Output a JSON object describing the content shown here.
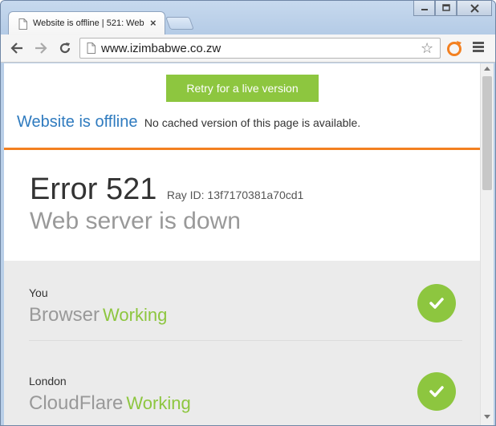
{
  "browser": {
    "tab": {
      "title": "Website is offline | 521: Web"
    },
    "address_bar": {
      "url": "www.izimbabwe.co.zw"
    }
  },
  "page": {
    "retry_button": "Retry for a live version",
    "offline_title": "Website is offline",
    "offline_message": "No cached version of this page is available.",
    "error_code": "Error 521",
    "ray_id": "Ray ID: 13f7170381a70cd1",
    "error_subtitle": "Web server is down",
    "status": [
      {
        "location": "You",
        "service": "Browser",
        "state": "Working"
      },
      {
        "location": "London",
        "service": "CloudFlare",
        "state": "Working"
      }
    ]
  },
  "colors": {
    "accent_green": "#8dc63f",
    "accent_orange": "#f38020",
    "link_blue": "#2f7bbf"
  },
  "icons": [
    "page-icon",
    "close-icon",
    "minimize-icon",
    "maximize-icon",
    "back-arrow-icon",
    "forward-arrow-icon",
    "reload-icon",
    "star-icon",
    "extension-icon",
    "menu-icon",
    "checkmark-icon"
  ]
}
